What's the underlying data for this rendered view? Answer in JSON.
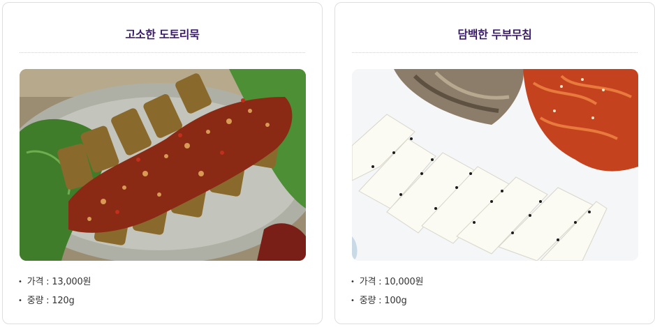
{
  "products": [
    {
      "title": "고소한 도토리묵",
      "image_alt": "acorn jelly with seasoning sauce on perilla leaves",
      "price": "가격 : 13,000원",
      "weight": "중량 : 120g"
    },
    {
      "title": "담백한 두부무침",
      "image_alt": "sliced tofu with black sesame, kimchi and side dishes",
      "price": "가격 : 10,000원",
      "weight": "중량 : 100g"
    }
  ],
  "bullet": "•"
}
